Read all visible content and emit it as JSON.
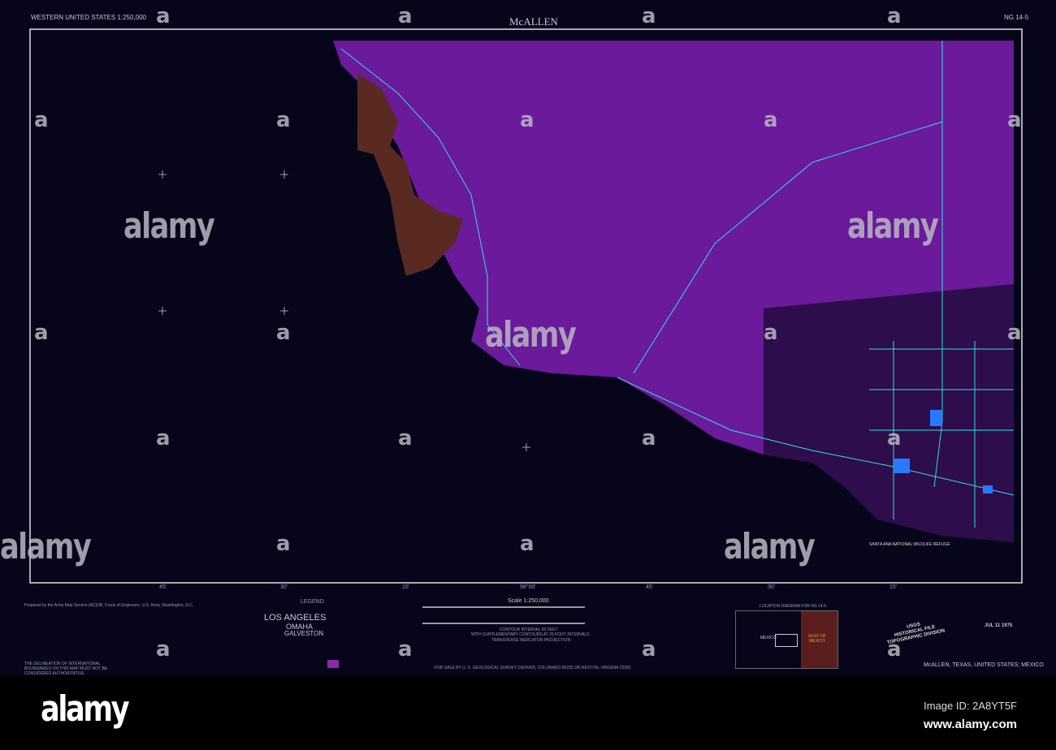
{
  "header": {
    "series": "WESTERN UNITED STATES 1:250,000",
    "title": "McALLEN",
    "sheet": "NG 14-5"
  },
  "ticks": [
    "45'",
    "30'",
    "15'",
    "98°00'",
    "45'",
    "30'",
    "15'"
  ],
  "map_labels": {
    "refuge": "SANTA ANA NATIONAL WILDLIFE REFUGE"
  },
  "notes": {
    "prepared": "Prepared by the Army Map Service (AC)DB, Corps of Engineers, U.S. Army, Washington, D.C.",
    "boundary": "THE DELINEATION OF INTERNATIONAL BOUNDARIES ON THIS MAP MUST NOT BE CONSIDERED AUTHORITATIVE"
  },
  "legend": {
    "title": "LEGEND",
    "cities": [
      "LOS ANGELES",
      "OMAHA",
      "GALVESTON"
    ]
  },
  "scale": {
    "label": "Scale 1:250,000",
    "contour": "CONTOUR INTERVAL 50 FEET",
    "supplementary": "WITH SUPPLEMENTARY CONTOURS AT 25 FOOT INTERVALS",
    "projection": "TRANSVERSE MERCATOR PROJECTION",
    "sale": "FOR SALE BY U. S. GEOLOGICAL SURVEY, DENVER, COLORADO 80225 OR RESTON, VIRGINIA 22092"
  },
  "location": {
    "title": "LOCATION DIAGRAM FOR NG 14-5",
    "mexico": "MEXICO",
    "gulf": "GULF OF MEXICO"
  },
  "stamp": {
    "line1": "USGS",
    "line2": "HISTORICAL FILE",
    "line3": "TOPOGRAPHIC DIVISION",
    "date": "JUL 11 1975"
  },
  "footer": {
    "place": "McALLEN, TEXAS, UNITED STATES; MEXICO"
  },
  "watermark": {
    "brand": "alamy",
    "mark": "a"
  },
  "banner": {
    "logo": "alamy",
    "image_id": "Image ID: 2A8YT5F",
    "url": "www.alamy.com"
  },
  "colors": {
    "land": "#6a1a9a",
    "reservoir": "#5a2a22",
    "roads": "#30e0e0",
    "water": "#2a7aff"
  }
}
